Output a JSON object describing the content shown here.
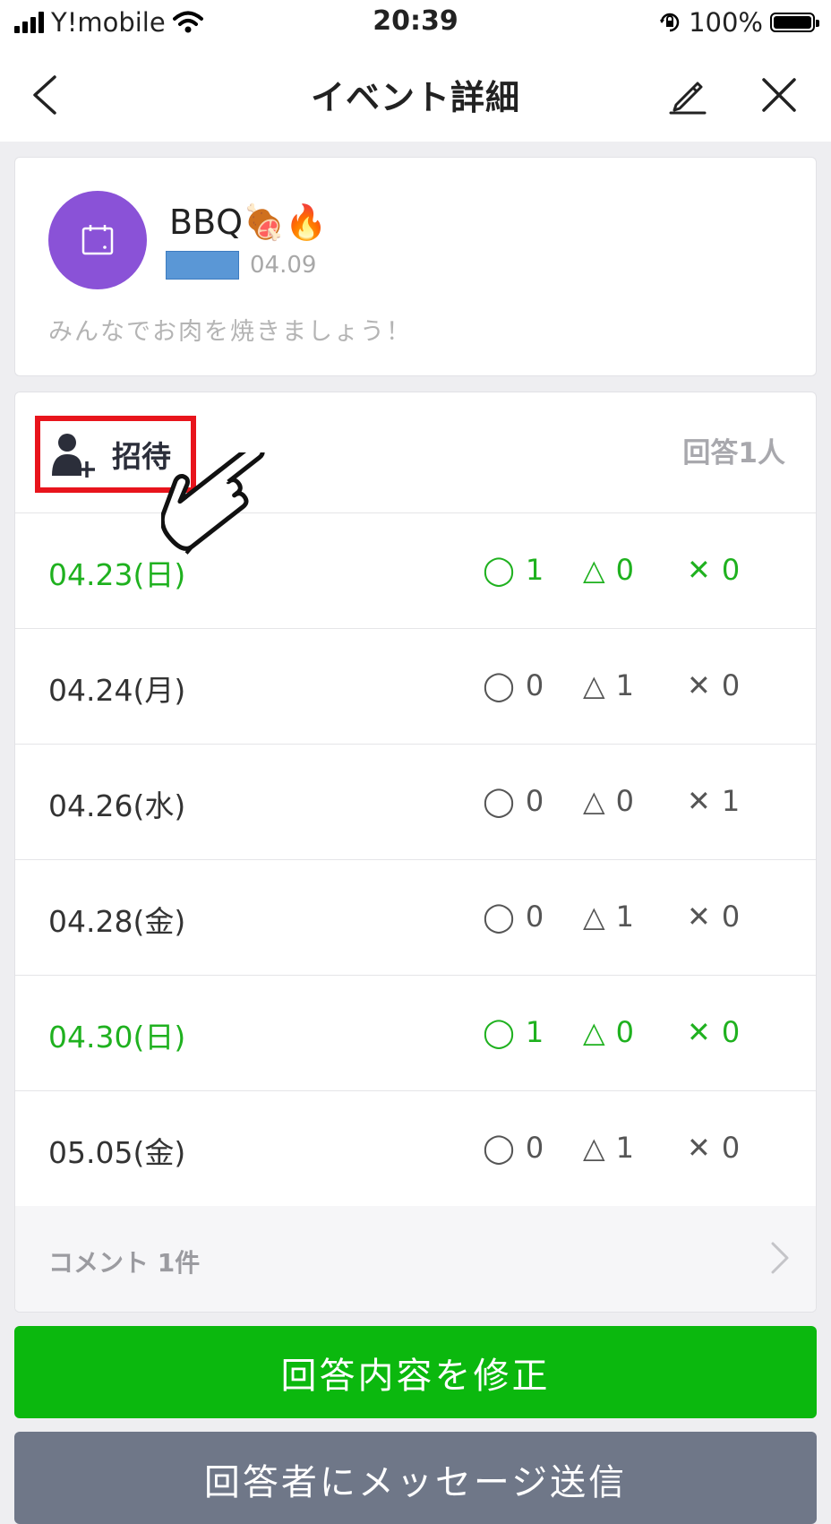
{
  "status_bar": {
    "carrier": "Y!mobile",
    "time": "20:39",
    "battery": "100%"
  },
  "header": {
    "title": "イベント詳細",
    "back_icon": "chevron-left-icon",
    "edit_icon": "pencil-icon",
    "close_icon": "close-icon"
  },
  "event": {
    "title": "BBQ🍖🔥",
    "date": "04.09",
    "description": "みんなでお肉を焼きましょう！",
    "avatar_color": "#8a52d7",
    "avatar_icon": "calendar-icon"
  },
  "invite": {
    "label": "招待",
    "icon": "add-person-icon",
    "response_count": "回答1人"
  },
  "symbols": {
    "yes": "◯",
    "maybe": "△",
    "no": "✕"
  },
  "dates": [
    {
      "label": "04.23(日)",
      "yes": "1",
      "maybe": "0",
      "no": "0",
      "highlight": true
    },
    {
      "label": "04.24(月)",
      "yes": "0",
      "maybe": "1",
      "no": "0",
      "highlight": false
    },
    {
      "label": "04.26(水)",
      "yes": "0",
      "maybe": "0",
      "no": "1",
      "highlight": false
    },
    {
      "label": "04.28(金)",
      "yes": "0",
      "maybe": "1",
      "no": "0",
      "highlight": false
    },
    {
      "label": "04.30(日)",
      "yes": "1",
      "maybe": "0",
      "no": "0",
      "highlight": true
    },
    {
      "label": "05.05(金)",
      "yes": "0",
      "maybe": "1",
      "no": "0",
      "highlight": false
    }
  ],
  "comments": {
    "label": "コメント 1件"
  },
  "buttons": {
    "edit_answer": "回答内容を修正",
    "message_respondents": "回答者にメッセージ送信"
  },
  "colors": {
    "accent_green": "#0bb80e",
    "highlight_red": "#e8141c",
    "gray_button": "#6f7788"
  }
}
